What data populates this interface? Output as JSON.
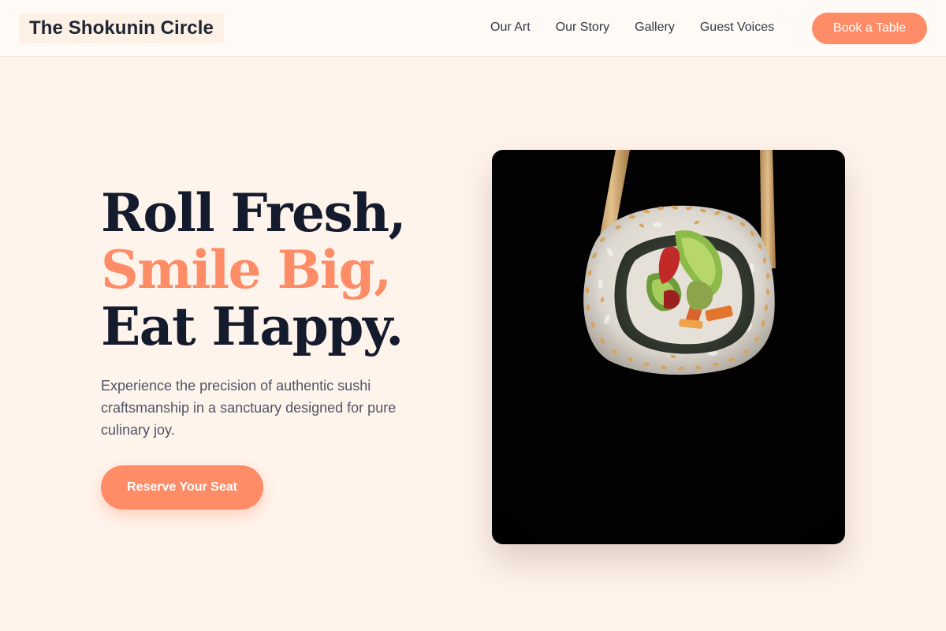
{
  "nav": {
    "brand": "The Shokunin Circle",
    "links": [
      "Our Art",
      "Our Story",
      "Gallery",
      "Guest Voices"
    ],
    "cta": "Book a Table"
  },
  "hero": {
    "title_line1": "Roll Fresh,",
    "title_line2": "Smile Big,",
    "title_line3": "Eat Happy.",
    "subtitle": "Experience the precision of authentic sushi craftsmanship in a sanctuary designed for pure culinary joy.",
    "cta": "Reserve Your Seat",
    "image_subject": "sushi roll held by chopsticks"
  },
  "colors": {
    "accent": "#fe8c66",
    "page_background": "#fff4ec",
    "heading": "#141b2d",
    "body_text": "#4d5564"
  }
}
